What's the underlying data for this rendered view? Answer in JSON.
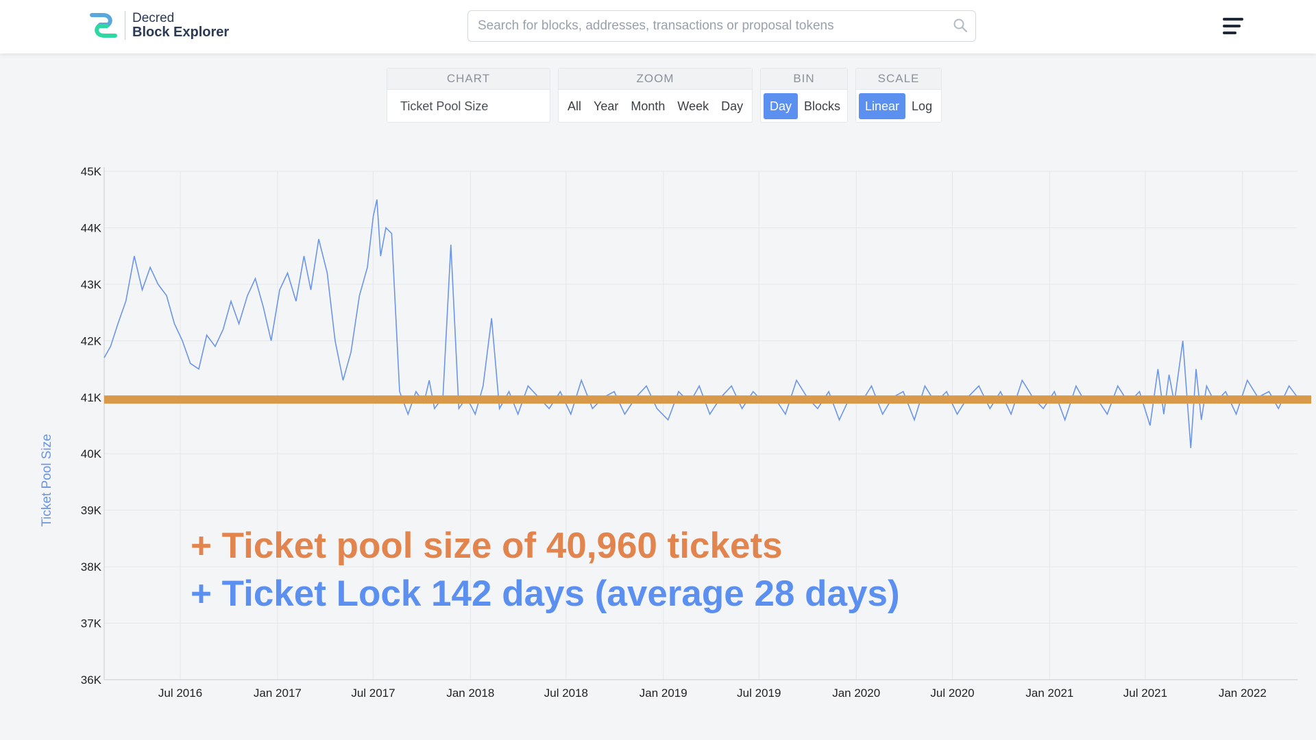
{
  "header": {
    "logo_line1": "Decred",
    "logo_line2": "Block Explorer",
    "search_placeholder": "Search for blocks, addresses, transactions or proposal tokens"
  },
  "controls": {
    "chart": {
      "label": "CHART",
      "value": "Ticket Pool Size"
    },
    "zoom": {
      "label": "ZOOM",
      "options": [
        "All",
        "Year",
        "Month",
        "Week",
        "Day"
      ]
    },
    "bin": {
      "label": "BIN",
      "options": [
        "Day",
        "Blocks"
      ],
      "selected": "Day"
    },
    "scale": {
      "label": "SCALE",
      "options": [
        "Linear",
        "Log"
      ],
      "selected": "Linear"
    }
  },
  "annotations": {
    "line1": "+ Ticket pool size of 40,960 tickets",
    "line2": "+ Ticket Lock 142 days (average 28 days)"
  },
  "colors": {
    "accent": "#5b8ff0",
    "series": "#6b95e6",
    "target_line": "#d89a4a",
    "annotation_orange": "#e2844e"
  },
  "chart_data": {
    "type": "line",
    "ylabel": "Ticket Pool Size",
    "ylim": [
      36000,
      45000
    ],
    "yticks": [
      "45K",
      "44K",
      "43K",
      "42K",
      "41K",
      "40K",
      "39K",
      "38K",
      "37K",
      "36K"
    ],
    "xticks": [
      "Jul 2016",
      "Jan 2017",
      "Jul 2017",
      "Jan 2018",
      "Jul 2018",
      "Jan 2019",
      "Jul 2019",
      "Jan 2020",
      "Jul 2020",
      "Jan 2021",
      "Jul 2021",
      "Jan 2022"
    ],
    "x_range": [
      "2016-02-08",
      "2022-04-15"
    ],
    "target_line": {
      "value": 40960
    },
    "series": [
      {
        "x": [
          "2016-02-08",
          "2016-02-20",
          "2016-03-05",
          "2016-03-20",
          "2016-04-05",
          "2016-04-20",
          "2016-05-05",
          "2016-05-20",
          "2016-06-05",
          "2016-06-20",
          "2016-07-05",
          "2016-07-20",
          "2016-08-05",
          "2016-08-20",
          "2016-09-05",
          "2016-09-20",
          "2016-10-05",
          "2016-10-20",
          "2016-11-05",
          "2016-11-20",
          "2016-12-05",
          "2016-12-20",
          "2017-01-05",
          "2017-01-20",
          "2017-02-05",
          "2017-02-20",
          "2017-03-05",
          "2017-03-20",
          "2017-04-05",
          "2017-04-20",
          "2017-05-05",
          "2017-05-20",
          "2017-06-05",
          "2017-06-20",
          "2017-07-01",
          "2017-07-08",
          "2017-07-15",
          "2017-07-25",
          "2017-08-05",
          "2017-08-20",
          "2017-09-05",
          "2017-09-20",
          "2017-10-05",
          "2017-10-15",
          "2017-10-25",
          "2017-11-10",
          "2017-11-25",
          "2017-12-10",
          "2017-12-25",
          "2018-01-10",
          "2018-01-25",
          "2018-02-10",
          "2018-02-25",
          "2018-03-15",
          "2018-04-01",
          "2018-04-20",
          "2018-05-10",
          "2018-05-30",
          "2018-06-20",
          "2018-07-10",
          "2018-07-30",
          "2018-08-20",
          "2018-09-10",
          "2018-09-30",
          "2018-10-20",
          "2018-11-10",
          "2018-11-30",
          "2018-12-20",
          "2019-01-10",
          "2019-01-30",
          "2019-02-20",
          "2019-03-10",
          "2019-03-30",
          "2019-04-20",
          "2019-05-10",
          "2019-05-30",
          "2019-06-20",
          "2019-07-10",
          "2019-07-30",
          "2019-08-20",
          "2019-09-10",
          "2019-09-30",
          "2019-10-20",
          "2019-11-10",
          "2019-11-30",
          "2019-12-20",
          "2020-01-10",
          "2020-01-30",
          "2020-02-20",
          "2020-03-10",
          "2020-03-30",
          "2020-04-20",
          "2020-05-10",
          "2020-05-30",
          "2020-06-20",
          "2020-07-10",
          "2020-07-30",
          "2020-08-20",
          "2020-09-10",
          "2020-09-30",
          "2020-10-20",
          "2020-11-10",
          "2020-11-30",
          "2020-12-20",
          "2021-01-10",
          "2021-01-30",
          "2021-02-20",
          "2021-03-10",
          "2021-03-30",
          "2021-04-20",
          "2021-05-10",
          "2021-05-30",
          "2021-06-20",
          "2021-07-10",
          "2021-07-25",
          "2021-08-05",
          "2021-08-15",
          "2021-08-25",
          "2021-09-10",
          "2021-09-25",
          "2021-10-05",
          "2021-10-15",
          "2021-10-25",
          "2021-11-10",
          "2021-11-30",
          "2021-12-20",
          "2022-01-10",
          "2022-01-30",
          "2022-02-20",
          "2022-03-10",
          "2022-03-30",
          "2022-04-15"
        ],
        "y": [
          41700,
          41900,
          42300,
          42700,
          43500,
          42900,
          43300,
          43000,
          42800,
          42300,
          42000,
          41600,
          41500,
          42100,
          41900,
          42200,
          42700,
          42300,
          42800,
          43100,
          42600,
          42000,
          42900,
          43200,
          42700,
          43500,
          42900,
          43800,
          43200,
          42000,
          41300,
          41800,
          42800,
          43300,
          44200,
          44500,
          43500,
          44000,
          43900,
          41100,
          40700,
          41100,
          40900,
          41300,
          40800,
          41000,
          43700,
          40800,
          41000,
          40700,
          41200,
          42400,
          40800,
          41100,
          40700,
          41200,
          41000,
          40800,
          41100,
          40700,
          41300,
          40800,
          41000,
          41100,
          40700,
          41000,
          41200,
          40800,
          40600,
          41100,
          40900,
          41200,
          40700,
          41000,
          41200,
          40800,
          41100,
          40900,
          41000,
          40700,
          41300,
          41000,
          40800,
          41100,
          40600,
          41000,
          40900,
          41200,
          40700,
          41000,
          41100,
          40600,
          41200,
          40900,
          41100,
          40700,
          41000,
          41200,
          40800,
          41100,
          40700,
          41300,
          41000,
          40800,
          41100,
          40600,
          41200,
          40900,
          41000,
          40700,
          41200,
          40900,
          41100,
          40500,
          41500,
          40700,
          41400,
          40900,
          42000,
          40100,
          41500,
          40600,
          41200,
          40900,
          41100,
          40700,
          41300,
          41000,
          41100,
          40800,
          41200,
          41000
        ]
      }
    ]
  }
}
